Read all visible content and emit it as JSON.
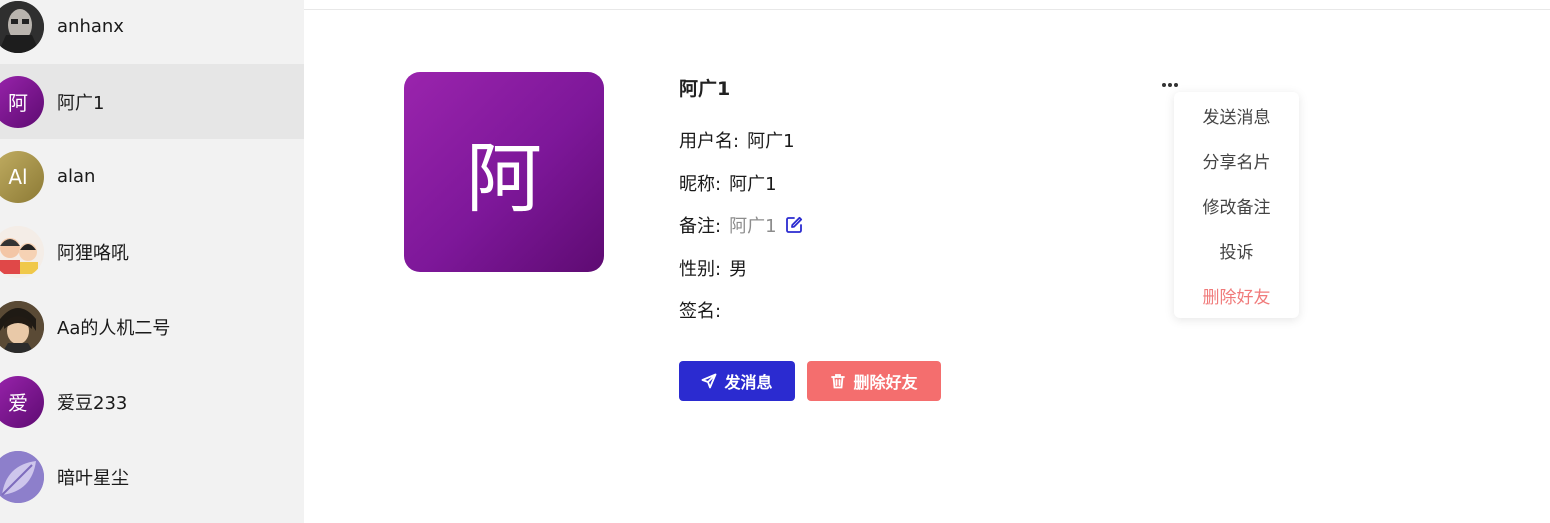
{
  "sidebar": {
    "contacts": [
      {
        "name": "anhanx",
        "avatar_type": "image",
        "avatar_icon": "photo-avatar-dark"
      },
      {
        "name": "阿广1",
        "avatar_type": "letter",
        "avatar_text": "阿",
        "active": true
      },
      {
        "name": "alan",
        "avatar_type": "letter",
        "avatar_text": "Al"
      },
      {
        "name": "阿狸咯吼",
        "avatar_type": "image",
        "avatar_icon": "cartoon-avatar"
      },
      {
        "name": "Aa的人机二号",
        "avatar_type": "image",
        "avatar_icon": "anime-avatar"
      },
      {
        "name": "爱豆233",
        "avatar_type": "letter",
        "avatar_text": "爱"
      },
      {
        "name": "暗叶星尘",
        "avatar_type": "image",
        "avatar_icon": "leaf-avatar"
      }
    ]
  },
  "profile": {
    "avatar_text": "阿",
    "name": "阿广1",
    "username_label": "用户名:",
    "username": "阿广1",
    "nickname_label": "昵称:",
    "nickname": "阿广1",
    "remark_label": "备注:",
    "remark": "阿广1",
    "gender_label": "性别:",
    "gender": "男",
    "signature_label": "签名:",
    "signature": ""
  },
  "actions": {
    "send_label": "发消息",
    "delete_label": "删除好友"
  },
  "menu": {
    "items": [
      "发送消息",
      "分享名片",
      "修改备注",
      "投诉",
      "删除好友"
    ]
  },
  "colors": {
    "accent": "#2b2bd0",
    "danger": "#f46e6e",
    "sidebar_bg": "#f2f2f2",
    "active_bg": "#e6e6e6"
  }
}
